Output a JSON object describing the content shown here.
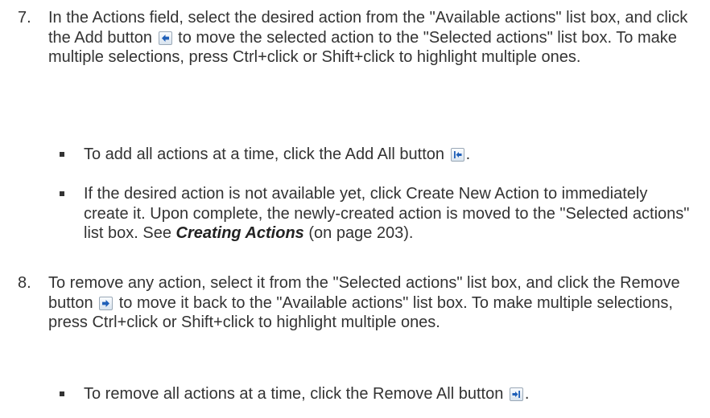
{
  "step7": {
    "number": "7.",
    "text_a": "In the Actions field, select the desired action from the \"Available actions\" list box, and click the Add button",
    "add_icon": "arrow-left-icon",
    "text_b": "to move the selected action to the \"Selected actions\" list box. To make multiple selections, press Ctrl+click or Shift+click to highlight multiple ones.",
    "bullets": [
      {
        "text_a": "To add all actions at a time, click the Add All button",
        "icon": "arrow-left-bar-icon",
        "text_b": "."
      },
      {
        "text_a": "If the desired action is not available yet, click Create New Action to immediately create it. Upon complete, the newly-created action is moved to the \"Selected actions\" list box. See",
        "link": "Creating Actions",
        "text_b": "(on page 203)."
      }
    ]
  },
  "step8": {
    "number": "8.",
    "text_a": "To remove any action, select it from the \"Selected actions\" list box, and click the Remove button",
    "remove_icon": "arrow-right-icon",
    "text_b": "to move it back to the \"Available actions\" list box. To make multiple selections, press Ctrl+click or Shift+click to highlight multiple ones.",
    "bullets": [
      {
        "text_a": "To remove all actions at a time, click the Remove All button",
        "icon": "arrow-right-bar-icon",
        "text_b": "."
      }
    ]
  },
  "colors": {
    "text": "#333333",
    "icon_arrow": "#1f5fb8"
  }
}
